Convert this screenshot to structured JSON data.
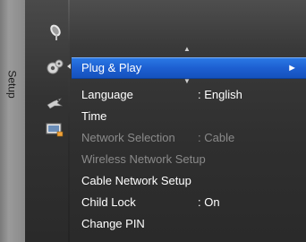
{
  "sidebar": {
    "label": "Setup"
  },
  "icons": [
    "satellite-dish-icon",
    "gear-icon",
    "bird-icon",
    "input-icon"
  ],
  "menu": {
    "items": [
      {
        "label": "Plug & Play",
        "value": "",
        "selected": true,
        "disabled": false,
        "arrow": "►"
      },
      {
        "label": "Language",
        "value": ": English",
        "selected": false,
        "disabled": false
      },
      {
        "label": "Time",
        "value": "",
        "selected": false,
        "disabled": false
      },
      {
        "label": "Network Selection",
        "value": ": Cable",
        "selected": false,
        "disabled": true
      },
      {
        "label": "Wireless Network Setup",
        "value": "",
        "selected": false,
        "disabled": true
      },
      {
        "label": "Cable Network Setup",
        "value": "",
        "selected": false,
        "disabled": false
      },
      {
        "label": "Child Lock",
        "value": ": On",
        "selected": false,
        "disabled": false
      },
      {
        "label": "Change PIN",
        "value": "",
        "selected": false,
        "disabled": false
      }
    ]
  },
  "colors": {
    "selection": "#1d5fd1",
    "text": "#ffffff",
    "disabled_text": "#8a8a8a"
  }
}
